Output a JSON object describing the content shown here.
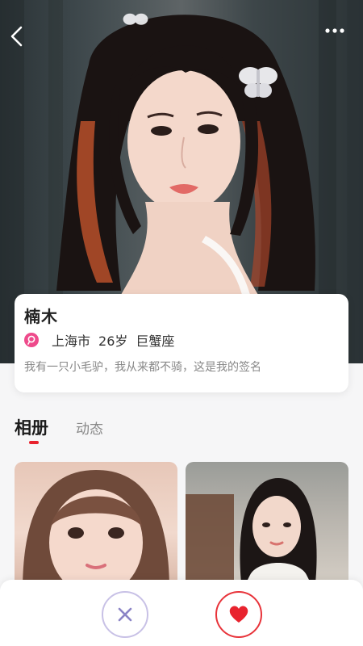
{
  "profile": {
    "name": "楠木",
    "city": "上海市",
    "age": "26岁",
    "zodiac": "巨蟹座",
    "signature": "我有一只小毛驴，我从来都不骑，这是我的签名"
  },
  "tabs": [
    {
      "label": "相册",
      "active": true
    },
    {
      "label": "动态",
      "active": false
    }
  ],
  "colors": {
    "accent_red": "#e8232e",
    "location_pink": "#ee4a8b",
    "dislike_border": "#c8c1e6",
    "like_red": "#e8333a"
  },
  "icons": {
    "back": "chevron-left-icon",
    "more": "more-horizontal-icon",
    "location": "location-pin-icon",
    "dislike": "close-icon",
    "like": "heart-icon"
  }
}
